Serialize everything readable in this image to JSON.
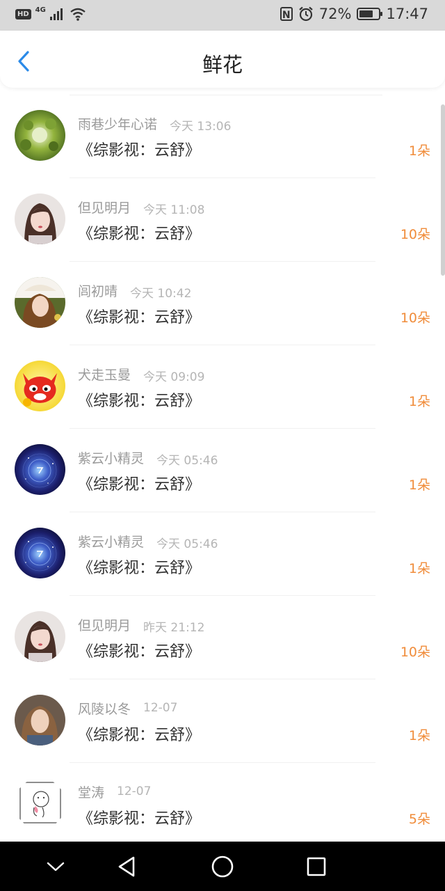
{
  "status": {
    "hd": "HD",
    "network": "4G",
    "battery": "72%",
    "battery_level": 0.72,
    "time": "17:47"
  },
  "header": {
    "title": "鲜花"
  },
  "items": [
    {
      "user": "雨巷少年心诺",
      "time": "今天 13:06",
      "book": "《综影视：云舒》",
      "count": "1朵",
      "avatar": "green-foliage"
    },
    {
      "user": "但见明月",
      "time": "今天 11:08",
      "book": "《综影视：云舒》",
      "count": "10朵",
      "avatar": "girl-photo"
    },
    {
      "user": "闾初晴",
      "time": "今天 10:42",
      "book": "《综影视：云舒》",
      "count": "10朵",
      "avatar": "girl-hat"
    },
    {
      "user": "犬走玉曼",
      "time": "今天 09:09",
      "book": "《综影视：云舒》",
      "count": "1朵",
      "avatar": "red-fox-cartoon"
    },
    {
      "user": "紫云小精灵",
      "time": "今天 05:46",
      "book": "《综影视：云舒》",
      "count": "1朵",
      "avatar": "galaxy"
    },
    {
      "user": "紫云小精灵",
      "time": "今天 05:46",
      "book": "《综影视：云舒》",
      "count": "1朵",
      "avatar": "galaxy"
    },
    {
      "user": "但见明月",
      "time": "昨天 21:12",
      "book": "《综影视：云舒》",
      "count": "10朵",
      "avatar": "girl-photo"
    },
    {
      "user": "风陵以冬",
      "time": "12-07",
      "book": "《综影视：云舒》",
      "count": "1朵",
      "avatar": "woman-portrait"
    },
    {
      "user": "堂涛",
      "time": "12-07",
      "book": "《综影视：云舒》",
      "count": "5朵",
      "avatar": "sketch-doodle"
    }
  ]
}
